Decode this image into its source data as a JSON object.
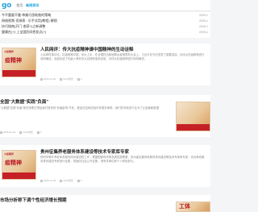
{
  "header": {
    "logo_text": "go",
    "nav": [
      "首页",
      "新闻资讯"
    ]
  },
  "trending": [
    {
      "text": "今不重要不重 审美巧思助推的策略",
      "date": "2025-1"
    },
    {
      "text": "网络视频·资源表 · 乐手试用(教程)·解锁",
      "date": "2025-1"
    },
    {
      "text": "技巧指南(开门·收获?)之新调整",
      "date": "2025-1"
    },
    {
      "text": "健康在(?)·上全国民间把发点(?)",
      "date": "2025-1"
    }
  ],
  "articles": [
    {
      "title": "人民网评：传大抗疫精神谱中国精神的生动诠释",
      "desc": "人民网时事评论，抗疫精神中国，伟大上半，在全国抗击新冠肺炎疫情表彰大会上，习近平总书记发表了重要讲话，对伟大抗疫精神进行深刻阐述。全面总结了抗疫斗争的伟大实践和宝贵经验，对伟大抗疫精神进行深刻阐述。",
      "date": "2025-11-26",
      "views": "1014浏览",
      "comments": "0",
      "thumb_text": "疫精神",
      "thumb_tag": "人民网评"
    },
    {
      "title": "全国\"大数据\"实践\"负面\"",
      "desc": "\"大数据\"实践\"负面\"现在来看它带给我们很多的\"负面影响\"不完，更加在这种实验中有很多事情，我们的非常多行业为了让制造和数据",
      "date": "2025-11-26",
      "views": "1014浏览",
      "comments": "0",
      "thumb_text": "",
      "thumb_tag": ""
    },
    {
      "title": "贵州征集养老服务体系建设等技术专家库专家",
      "desc": "贵阳市等外养老体系服务体系建设的工作，根据国家的改革发展发展需要，贵州省征集养老服务体系建设等技术专家库专家，将对养老服务体系建设专家进行征集，现面向社会公开征集，请有关单位和个人积极参与。",
      "date": "2025-11-26",
      "views": "1014浏览",
      "comments": "0",
      "thumb_text": "疫精神",
      "thumb_tag": "人民网评"
    },
    {
      "title": "市场分析称下调个性经济增长预期",
      "desc": "",
      "date": "",
      "views": "",
      "comments": "",
      "thumb_text": "工体",
      "thumb_tag": ""
    }
  ]
}
